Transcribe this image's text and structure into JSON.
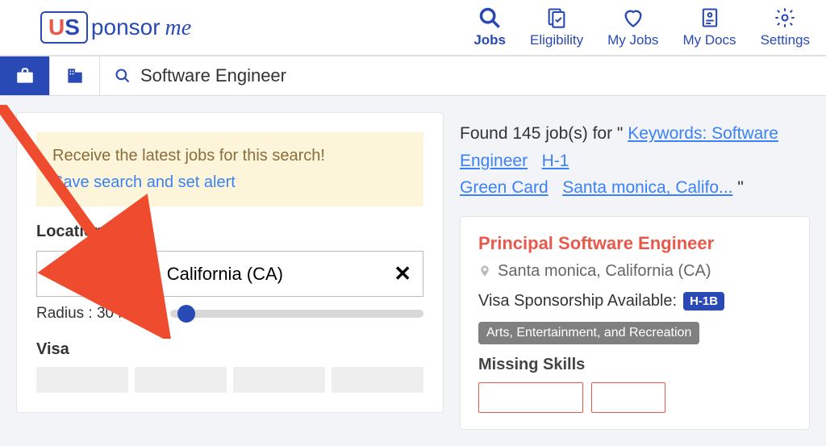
{
  "logo": {
    "u": "U",
    "s": "S",
    "rest": "ponsor",
    "me": "me"
  },
  "nav": {
    "jobs": "Jobs",
    "eligibility": "Eligibility",
    "myjobs": "My Jobs",
    "mydocs": "My Docs",
    "settings": "Settings"
  },
  "search": {
    "value": "Software Engineer"
  },
  "alert": {
    "title": "Receive the latest jobs for this search!",
    "link": "Save search and set alert"
  },
  "location": {
    "label": "Location",
    "value": "Santa monica, California (CA)",
    "radius_text": "Radius : 30 miles"
  },
  "visa_label": "Visa",
  "results": {
    "prefix": "Found 145 job(s) for \" ",
    "kw_link": "Keywords: Software Engineer",
    "h1_link": "H-1",
    "gc_link": "Green Card",
    "loc_link": "Santa monica, Califo...",
    "suffix": " \""
  },
  "job": {
    "title": "Principal Software Engineer",
    "location": "Santa monica, California (CA)",
    "visa_label": "Visa Sponsorship Available:",
    "visa_badge": "H-1B",
    "category": "Arts, Entertainment, and Recreation",
    "missing_label": "Missing Skills"
  }
}
